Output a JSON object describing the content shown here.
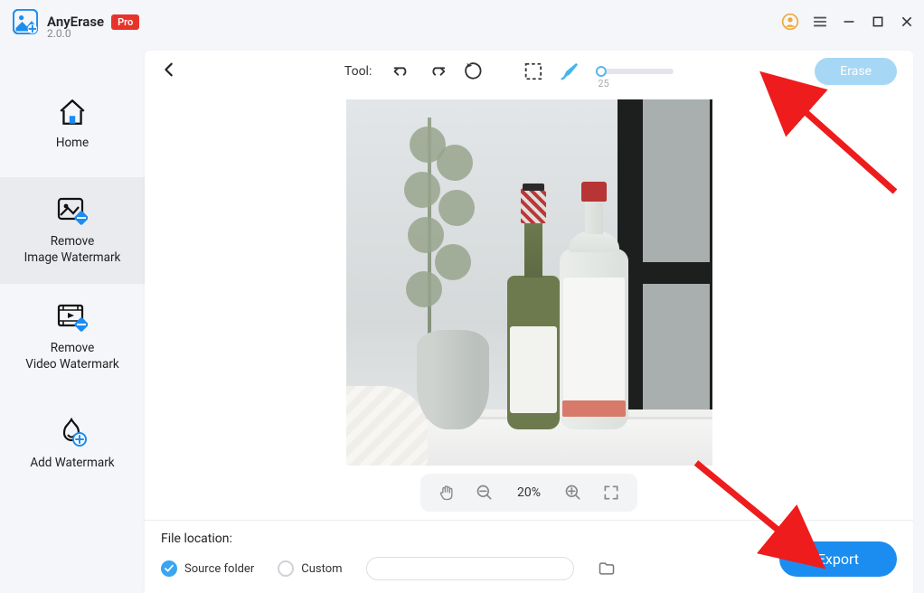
{
  "app": {
    "name": "AnyErase",
    "badge": "Pro",
    "version": "2.0.0"
  },
  "sidebar": {
    "items": [
      {
        "label": "Home"
      },
      {
        "label": "Remove\nImage Watermark"
      },
      {
        "label": "Remove\nVideo Watermark"
      },
      {
        "label": "Add Watermark"
      }
    ],
    "active_index": 1
  },
  "toolbar": {
    "tool_label": "Tool:",
    "slider_value": "25",
    "erase_label": "Erase"
  },
  "zoom": {
    "percent": "20%"
  },
  "footer": {
    "section_label": "File location:",
    "option_source": "Source folder",
    "option_custom": "Custom",
    "custom_path": "",
    "export_label": "Export",
    "selected": "source"
  }
}
